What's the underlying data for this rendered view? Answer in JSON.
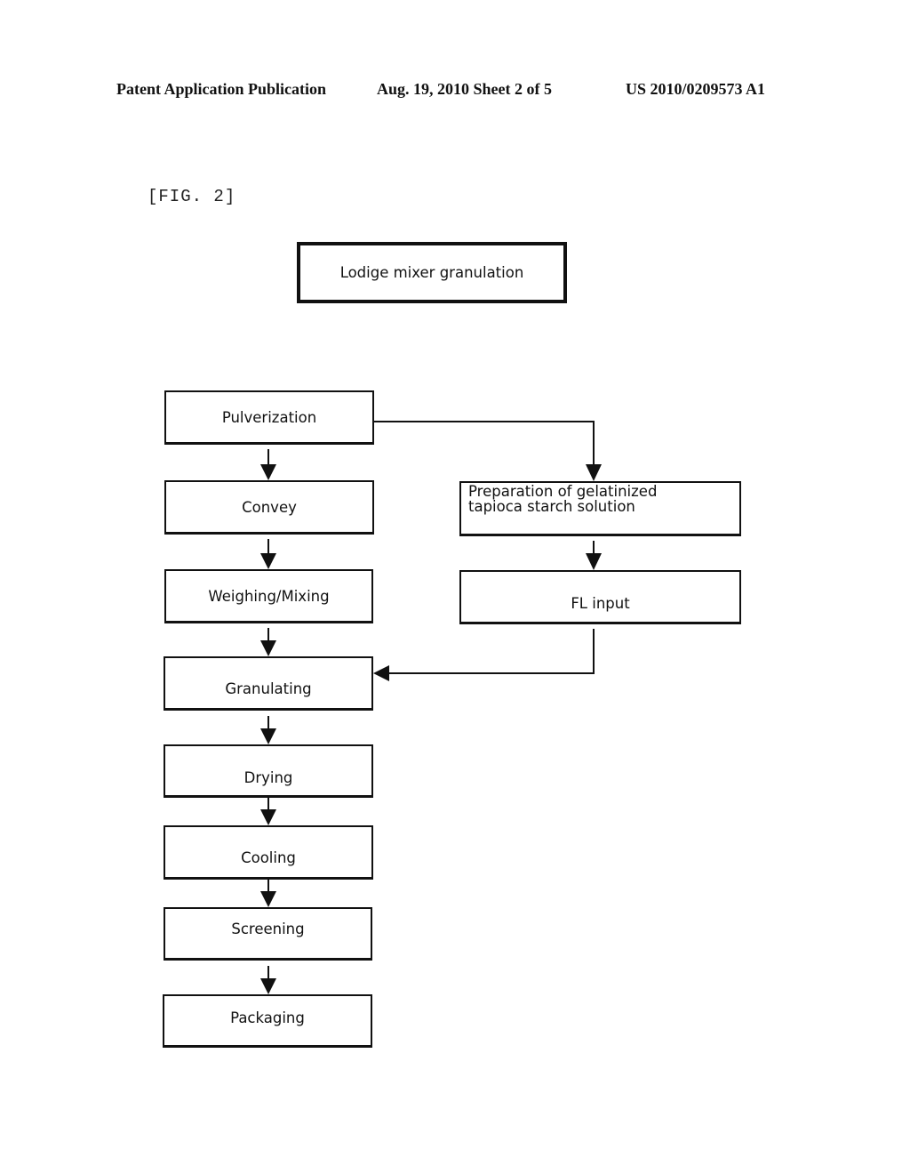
{
  "header": {
    "publication": "Patent Application Publication",
    "date_sheet": "Aug. 19, 2010  Sheet 2 of 5",
    "number": "US 2010/0209573 A1"
  },
  "figure": {
    "label": "[FIG. 2]",
    "title": "Lodige mixer granulation",
    "main_flow": [
      "Pulverization",
      "Convey",
      "Weighing/Mixing",
      "Granulating",
      "Drying",
      "Cooling",
      "Screening",
      "Packaging"
    ],
    "side_flow": [
      "Preparation of gelatinized tapioca starch solution",
      "FL input"
    ],
    "connections": [
      {
        "from": "Pulverization",
        "to": "Convey"
      },
      {
        "from": "Convey",
        "to": "Weighing/Mixing"
      },
      {
        "from": "Weighing/Mixing",
        "to": "Granulating"
      },
      {
        "from": "Granulating",
        "to": "Drying"
      },
      {
        "from": "Drying",
        "to": "Cooling"
      },
      {
        "from": "Cooling",
        "to": "Screening"
      },
      {
        "from": "Screening",
        "to": "Packaging"
      },
      {
        "from": "Pulverization",
        "to": "Preparation of gelatinized tapioca starch solution"
      },
      {
        "from": "Preparation of gelatinized tapioca starch solution",
        "to": "FL input"
      },
      {
        "from": "FL input",
        "to": "Granulating"
      }
    ]
  }
}
